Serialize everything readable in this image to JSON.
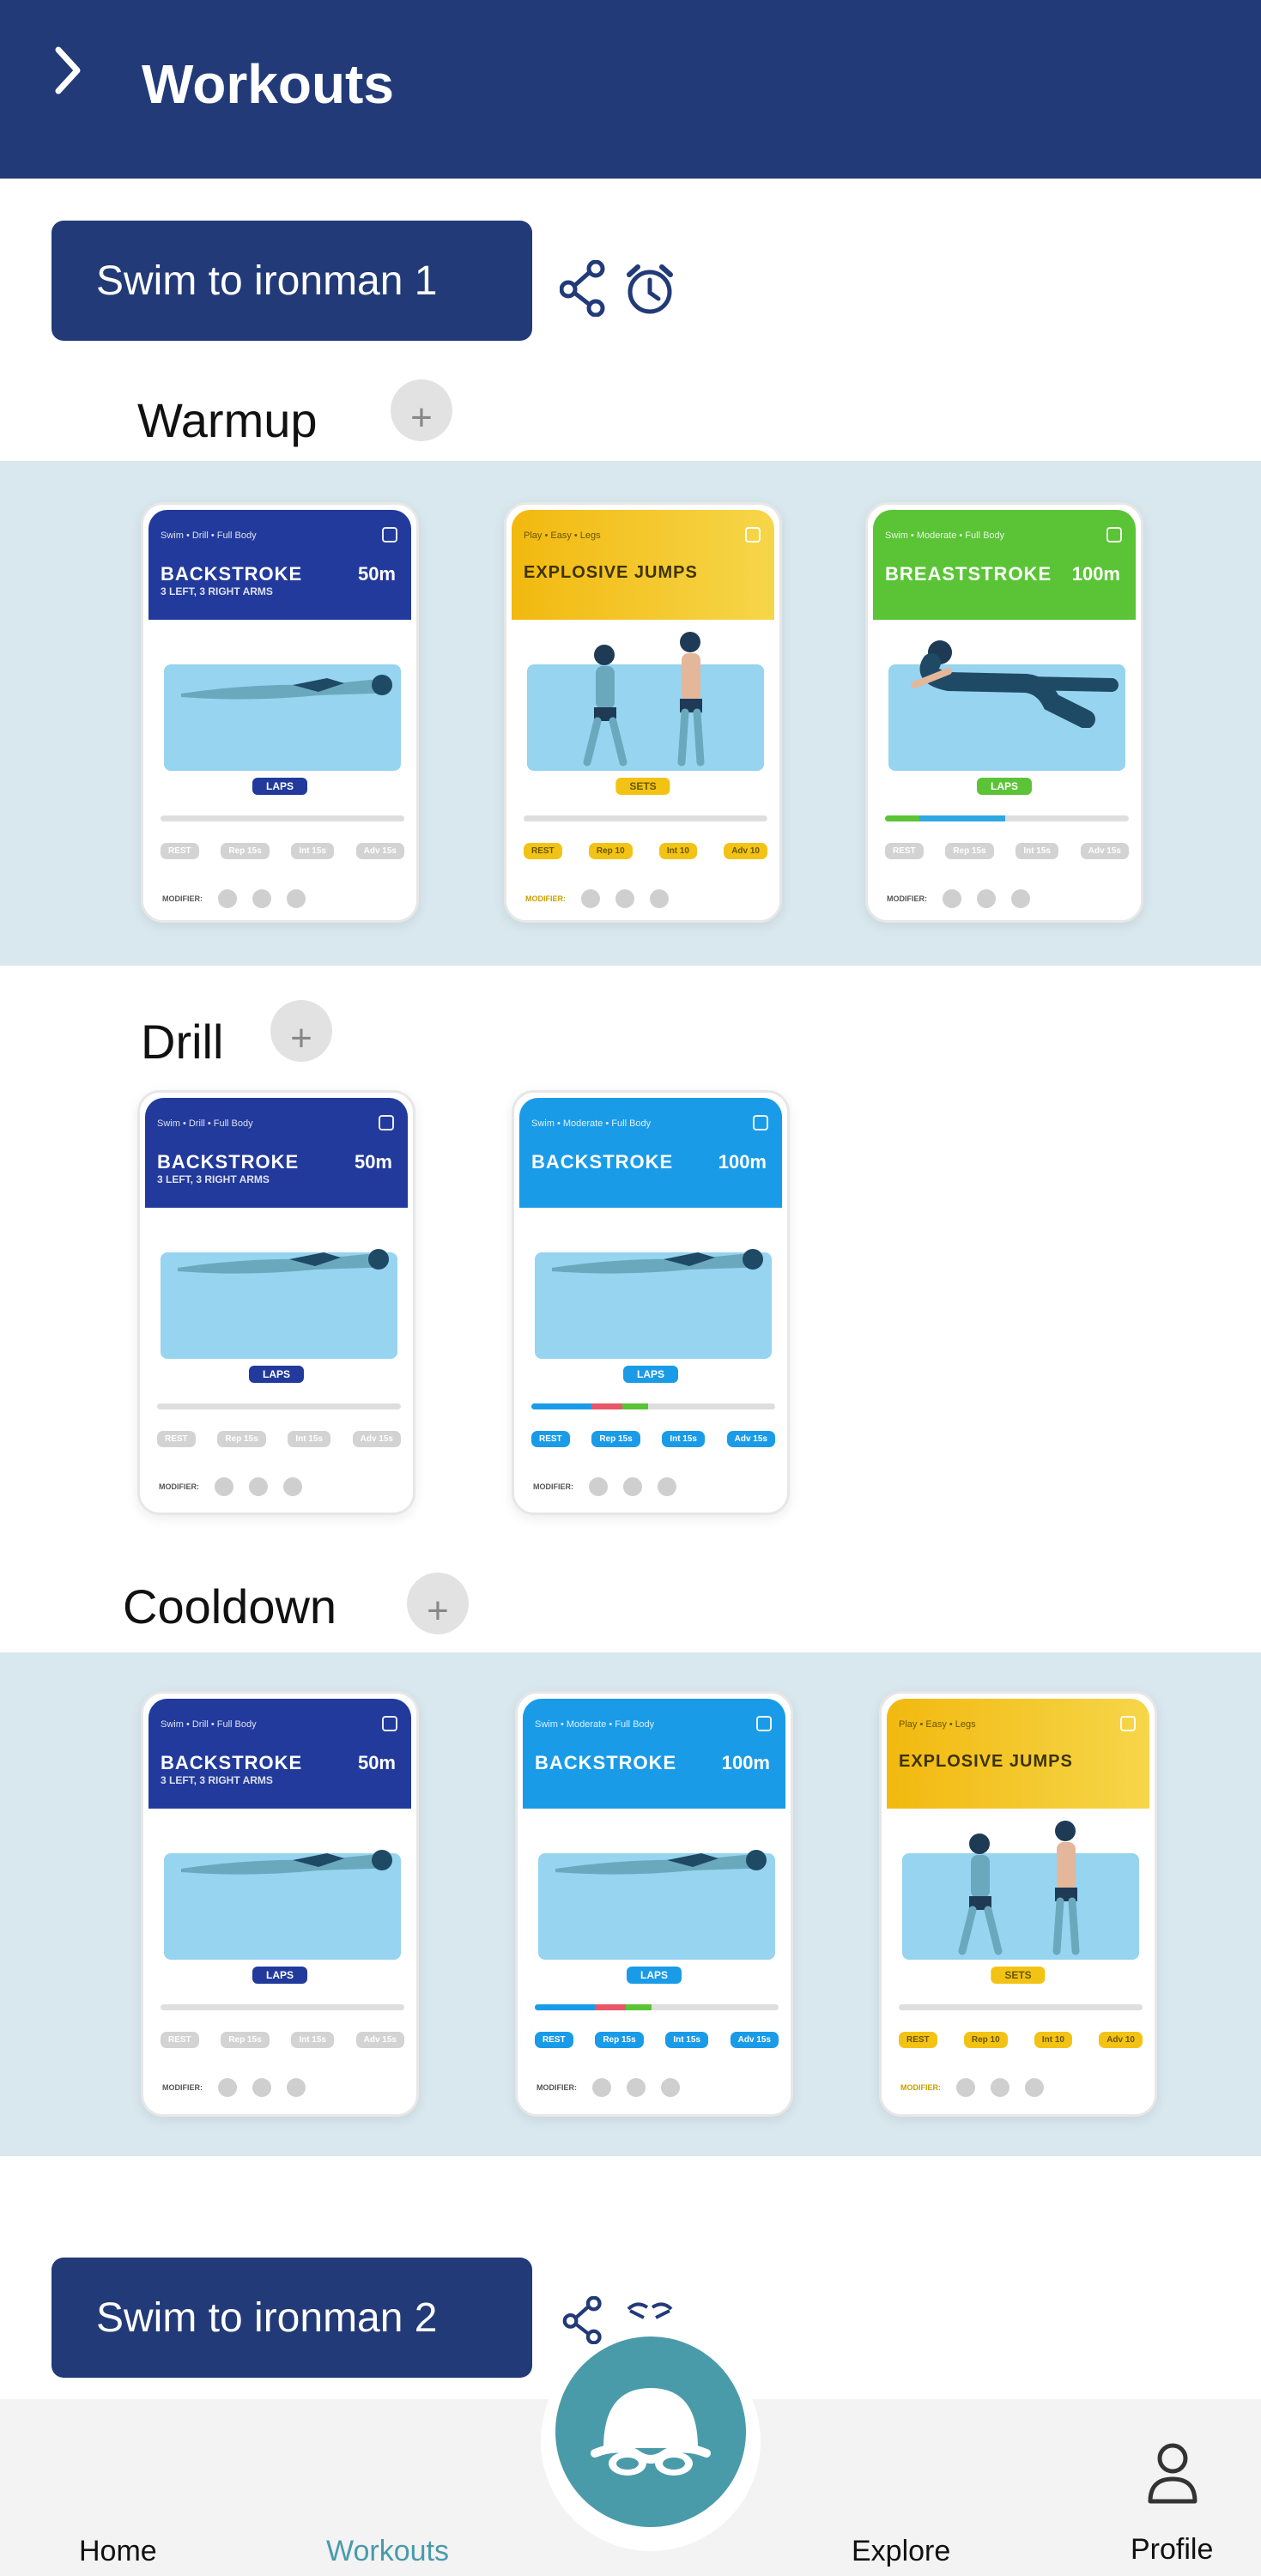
{
  "header": {
    "title": "Workouts"
  },
  "workouts": [
    {
      "name": "Swim to ironman 1"
    },
    {
      "name": "Swim to ironman 2"
    }
  ],
  "sections": [
    {
      "title": "Warmup",
      "add": "+"
    },
    {
      "title": "Drill",
      "add": "+"
    },
    {
      "title": "Cooldown",
      "add": "+"
    }
  ],
  "cards": {
    "backstroke_drill": {
      "tags": "Swim • Drill • Full Body",
      "name": "BACKSTROKE",
      "sub": "3 LEFT, 3 RIGHT ARMS",
      "dist": "50m",
      "unit": "LAPS",
      "chips": [
        "REST",
        "Rep 15s",
        "Int 15s",
        "Adv 15s"
      ],
      "footer": "MODIFIER:",
      "color": "#223a9b"
    },
    "explosive_jumps": {
      "tags": "Play • Easy • Legs",
      "name": "EXPLOSIVE JUMPS",
      "sub": "",
      "dist": "",
      "unit": "SETS",
      "chips": [
        "REST",
        "Rep 10",
        "Int 10",
        "Adv 10"
      ],
      "footer": "MODIFIER:",
      "color": "#f2c314"
    },
    "breaststroke": {
      "tags": "Swim • Moderate • Full Body",
      "name": "BREASTSTROKE",
      "sub": "",
      "dist": "100m",
      "unit": "LAPS",
      "chips": [
        "REST",
        "Rep 15s",
        "Int 15s",
        "Adv 15s"
      ],
      "footer": "MODIFIER:",
      "color": "#5ac436"
    },
    "backstroke": {
      "tags": "Swim • Moderate • Full Body",
      "name": "BACKSTROKE",
      "sub": "",
      "dist": "100m",
      "unit": "LAPS",
      "chips": [
        "REST",
        "Rep 15s",
        "Int 15s",
        "Adv 15s"
      ],
      "footer": "MODIFIER:",
      "color": "#1a9be8"
    }
  },
  "tabs": [
    {
      "label": "Home"
    },
    {
      "label": "Workouts"
    },
    {
      "label": "Explore"
    },
    {
      "label": "Profile"
    }
  ],
  "colors": {
    "primary": "#223a78",
    "active_tab": "#4a9baa",
    "band": "#d8e8ee"
  }
}
